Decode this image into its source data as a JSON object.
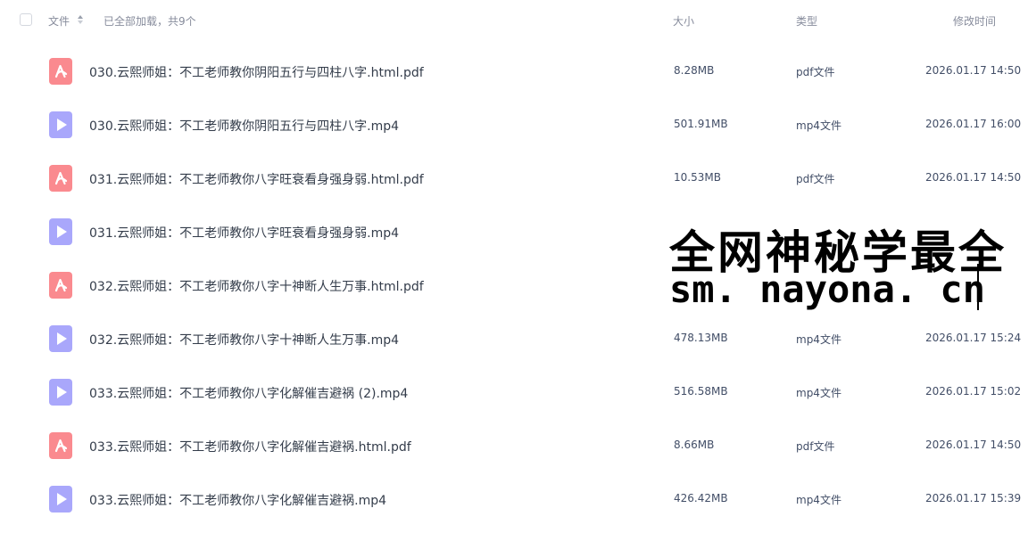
{
  "header": {
    "name_label": "文件",
    "summary": "已全部加载，共9个",
    "size_label": "大小",
    "type_label": "类型",
    "time_label": "修改时间"
  },
  "files": [
    {
      "icon": "pdf-file-icon",
      "name": "030.云熙师姐：不工老师教你阴阳五行与四柱八字.html.pdf",
      "size": "8.28MB",
      "type": "pdf文件",
      "time": "2026.01.17 14:50"
    },
    {
      "icon": "video-file-icon",
      "name": "030.云熙师姐：不工老师教你阴阳五行与四柱八字.mp4",
      "size": "501.91MB",
      "type": "mp4文件",
      "time": "2026.01.17 16:00"
    },
    {
      "icon": "pdf-file-icon",
      "name": "031.云熙师姐：不工老师教你八字旺衰看身强身弱.html.pdf",
      "size": "10.53MB",
      "type": "pdf文件",
      "time": "2026.01.17 14:50"
    },
    {
      "icon": "video-file-icon",
      "name": "031.云熙师姐：不工老师教你八字旺衰看身强身弱.mp4",
      "size": "",
      "type": "",
      "time": ""
    },
    {
      "icon": "pdf-file-icon",
      "name": "032.云熙师姐：不工老师教你八字十神断人生万事.html.pdf",
      "size": "",
      "type": "",
      "time": ""
    },
    {
      "icon": "video-file-icon",
      "name": "032.云熙师姐：不工老师教你八字十神断人生万事.mp4",
      "size": "478.13MB",
      "type": "mp4文件",
      "time": "2026.01.17 15:24"
    },
    {
      "icon": "video-file-icon",
      "name": "033.云熙师姐：不工老师教你八字化解催吉避祸 (2).mp4",
      "size": "516.58MB",
      "type": "mp4文件",
      "time": "2026.01.17 15:02"
    },
    {
      "icon": "pdf-file-icon",
      "name": "033.云熙师姐：不工老师教你八字化解催吉避祸.html.pdf",
      "size": "8.66MB",
      "type": "pdf文件",
      "time": "2026.01.17 14:50"
    },
    {
      "icon": "video-file-icon",
      "name": "033.云熙师姐：不工老师教你八字化解催吉避祸.mp4",
      "size": "426.42MB",
      "type": "mp4文件",
      "time": "2026.01.17 15:39"
    }
  ],
  "overlay": {
    "line1": "全网神秘学最全",
    "line2": "sm. nayona. cn"
  },
  "colors": {
    "pdf_icon": "#fa8a8f",
    "video_icon": "#a9a7fb",
    "header_text": "#878c9c",
    "body_text": "#333c4a"
  }
}
